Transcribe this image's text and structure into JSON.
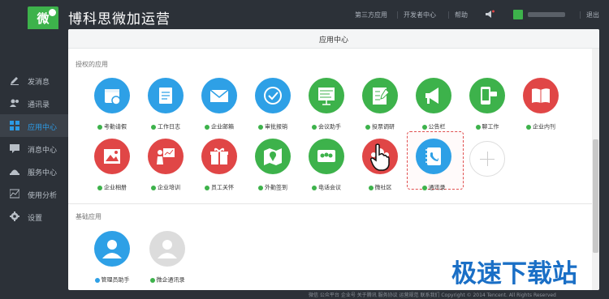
{
  "header": {
    "logo_text": "微",
    "title": "博科思微加运营",
    "nav": [
      "第三方应用",
      "开发者中心",
      "帮助"
    ],
    "logout": "退出"
  },
  "sidebar": {
    "items": [
      {
        "label": "发消息",
        "icon": "pencil-icon"
      },
      {
        "label": "通讯录",
        "icon": "contacts-icon"
      },
      {
        "label": "应用中心",
        "icon": "apps-icon",
        "active": true
      },
      {
        "label": "消息中心",
        "icon": "message-icon"
      },
      {
        "label": "服务中心",
        "icon": "service-icon"
      },
      {
        "label": "使用分析",
        "icon": "chart-icon"
      },
      {
        "label": "设置",
        "icon": "gear-icon"
      }
    ]
  },
  "panel": {
    "title": "应用中心",
    "authorized_label": "授权的应用",
    "basic_label": "基础应用"
  },
  "authorized_apps": [
    {
      "label": "考勤请假",
      "color": "#2ea0e6",
      "icon": "calendar-icon"
    },
    {
      "label": "工作日志",
      "color": "#2ea0e6",
      "icon": "notebook-icon"
    },
    {
      "label": "企业邮箱",
      "color": "#2ea0e6",
      "icon": "mail-icon"
    },
    {
      "label": "审批报销",
      "color": "#2ea0e6",
      "icon": "check-icon"
    },
    {
      "label": "会议助手",
      "color": "#3db24b",
      "icon": "board-icon"
    },
    {
      "label": "投票调研",
      "color": "#3db24b",
      "icon": "survey-icon"
    },
    {
      "label": "公告栏",
      "color": "#3db24b",
      "icon": "megaphone-icon"
    },
    {
      "label": "聊工作",
      "color": "#3db24b",
      "icon": "phone-chat-icon"
    },
    {
      "label": "企业内刊",
      "color": "#e04646",
      "icon": "book-icon"
    },
    {
      "label": "企业相册",
      "color": "#e04646",
      "icon": "photo-icon"
    },
    {
      "label": "企业培训",
      "color": "#e04646",
      "icon": "teacher-icon"
    },
    {
      "label": "员工关怀",
      "color": "#e04646",
      "icon": "gift-icon"
    },
    {
      "label": "外勤签到",
      "color": "#3db24b",
      "icon": "map-pin-icon"
    },
    {
      "label": "电话会议",
      "color": "#3db24b",
      "icon": "conference-icon"
    },
    {
      "label": "微社区",
      "color": "#e04646",
      "icon": "community-icon"
    },
    {
      "label": "通讯录",
      "color": "#2ea0e6",
      "icon": "address-book-icon"
    }
  ],
  "basic_apps": [
    {
      "label": "管理员助手",
      "color": "#2ea0e6",
      "icon": "admin-icon"
    },
    {
      "label": "微企通讯录",
      "color": "#dcdcdc",
      "icon": "user-gray-icon"
    }
  ],
  "footer": {
    "text": "微信  公众平台  企业号  关于腾讯  服务协议  运营规范  联系我们  Copyright © 2014 Tencent. All Rights Reserved"
  },
  "watermark": "极速下载站"
}
